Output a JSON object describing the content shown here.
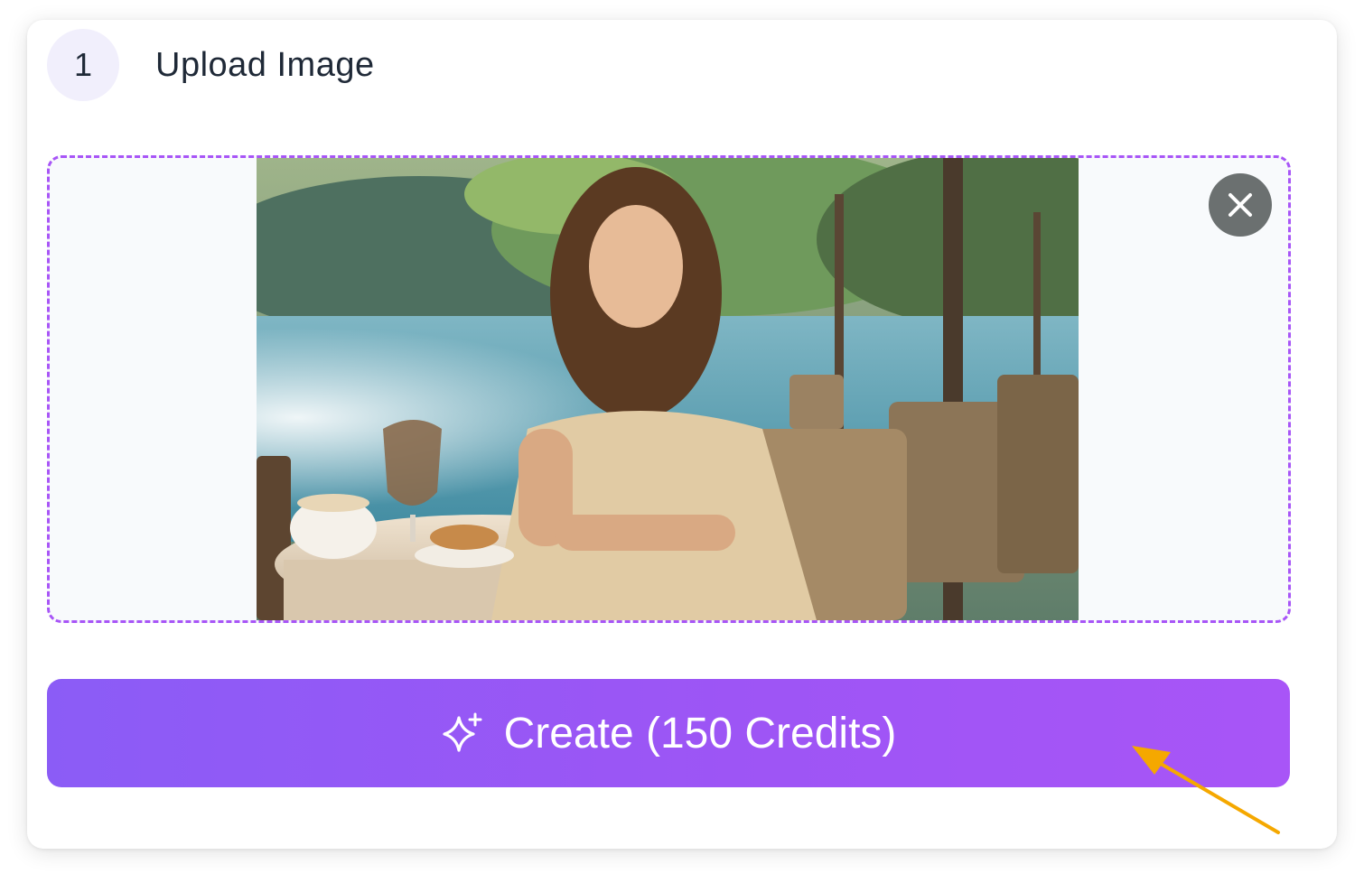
{
  "step": {
    "number": "1",
    "title": "Upload Image"
  },
  "upload": {
    "remove_icon": "close-icon",
    "image_subject": "photo-preview"
  },
  "action": {
    "label": "Create (150 Credits)",
    "icon": "sparkle-icon"
  },
  "colors": {
    "accent": "#a855f7",
    "button_start": "#8b5cf6",
    "button_end": "#a855f7",
    "annotation_arrow": "#f5a800"
  }
}
